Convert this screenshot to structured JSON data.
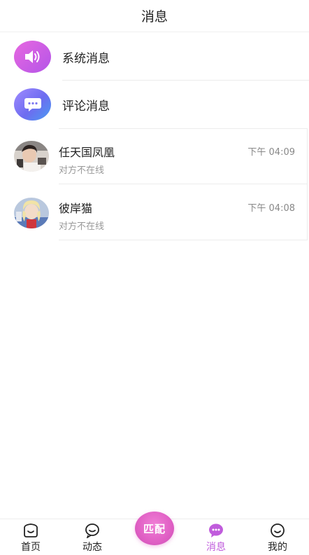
{
  "header": {
    "title": "消息"
  },
  "system_items": [
    {
      "label": "系统消息",
      "icon": "speaker-icon",
      "colors": [
        "#e768e0",
        "#b455e8"
      ]
    },
    {
      "label": "评论消息",
      "icon": "chat-bubble-icon",
      "colors": [
        "#a08bff",
        "#4a9cf2"
      ]
    }
  ],
  "chats": [
    {
      "name": "任天国凤凰",
      "time": "下午 04:09",
      "status": "对方不在线"
    },
    {
      "name": "彼岸猫",
      "time": "下午 04:08",
      "status": "对方不在线"
    }
  ],
  "tabbar": {
    "items": [
      {
        "label": "首页",
        "icon": "home-icon"
      },
      {
        "label": "动态",
        "icon": "moments-icon"
      },
      {
        "label": "消息",
        "icon": "message-icon",
        "active": true
      },
      {
        "label": "我的",
        "icon": "profile-icon"
      }
    ],
    "match_label": "匹配",
    "accent_color": "#c05cdc"
  }
}
